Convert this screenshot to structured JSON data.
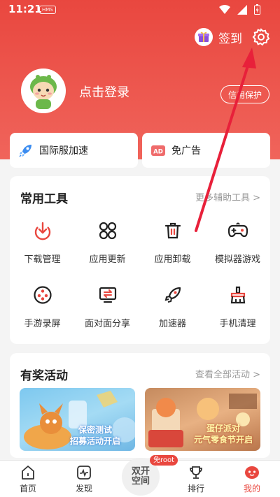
{
  "status": {
    "time": "11:21",
    "badge": "HMS"
  },
  "header": {
    "signin_label": "签到",
    "login_text": "点击登录",
    "credit_label": "信用保护"
  },
  "quick": [
    {
      "label": "国际服加速",
      "icon": "rocket-icon"
    },
    {
      "label": "免广告",
      "icon": "ad-icon"
    }
  ],
  "tools": {
    "title": "常用工具",
    "more": "更多辅助工具 >",
    "items": [
      {
        "label": "下载管理",
        "icon": "download-icon"
      },
      {
        "label": "应用更新",
        "icon": "app-update-icon"
      },
      {
        "label": "应用卸载",
        "icon": "trash-icon"
      },
      {
        "label": "模拟器游戏",
        "icon": "gamepad-icon"
      },
      {
        "label": "手游录屏",
        "icon": "record-icon"
      },
      {
        "label": "面对面分享",
        "icon": "share-icon"
      },
      {
        "label": "加速器",
        "icon": "rocket-icon"
      },
      {
        "label": "手机清理",
        "icon": "broom-icon"
      }
    ]
  },
  "events": {
    "title": "有奖活动",
    "more": "查看全部活动 >",
    "banners": [
      {
        "text": "保密测试\n招募活动开启"
      },
      {
        "text": "蛋仔派对\n元气零食节开启"
      }
    ]
  },
  "nav": {
    "items": [
      {
        "label": "首页",
        "icon": "home-icon"
      },
      {
        "label": "发现",
        "icon": "discover-icon"
      },
      {
        "label": "排行",
        "icon": "trophy-icon"
      },
      {
        "label": "我的",
        "icon": "profile-icon"
      }
    ],
    "center_label": "双开空间",
    "center_badge": "免root"
  },
  "colors": {
    "accent": "#e9473f"
  }
}
